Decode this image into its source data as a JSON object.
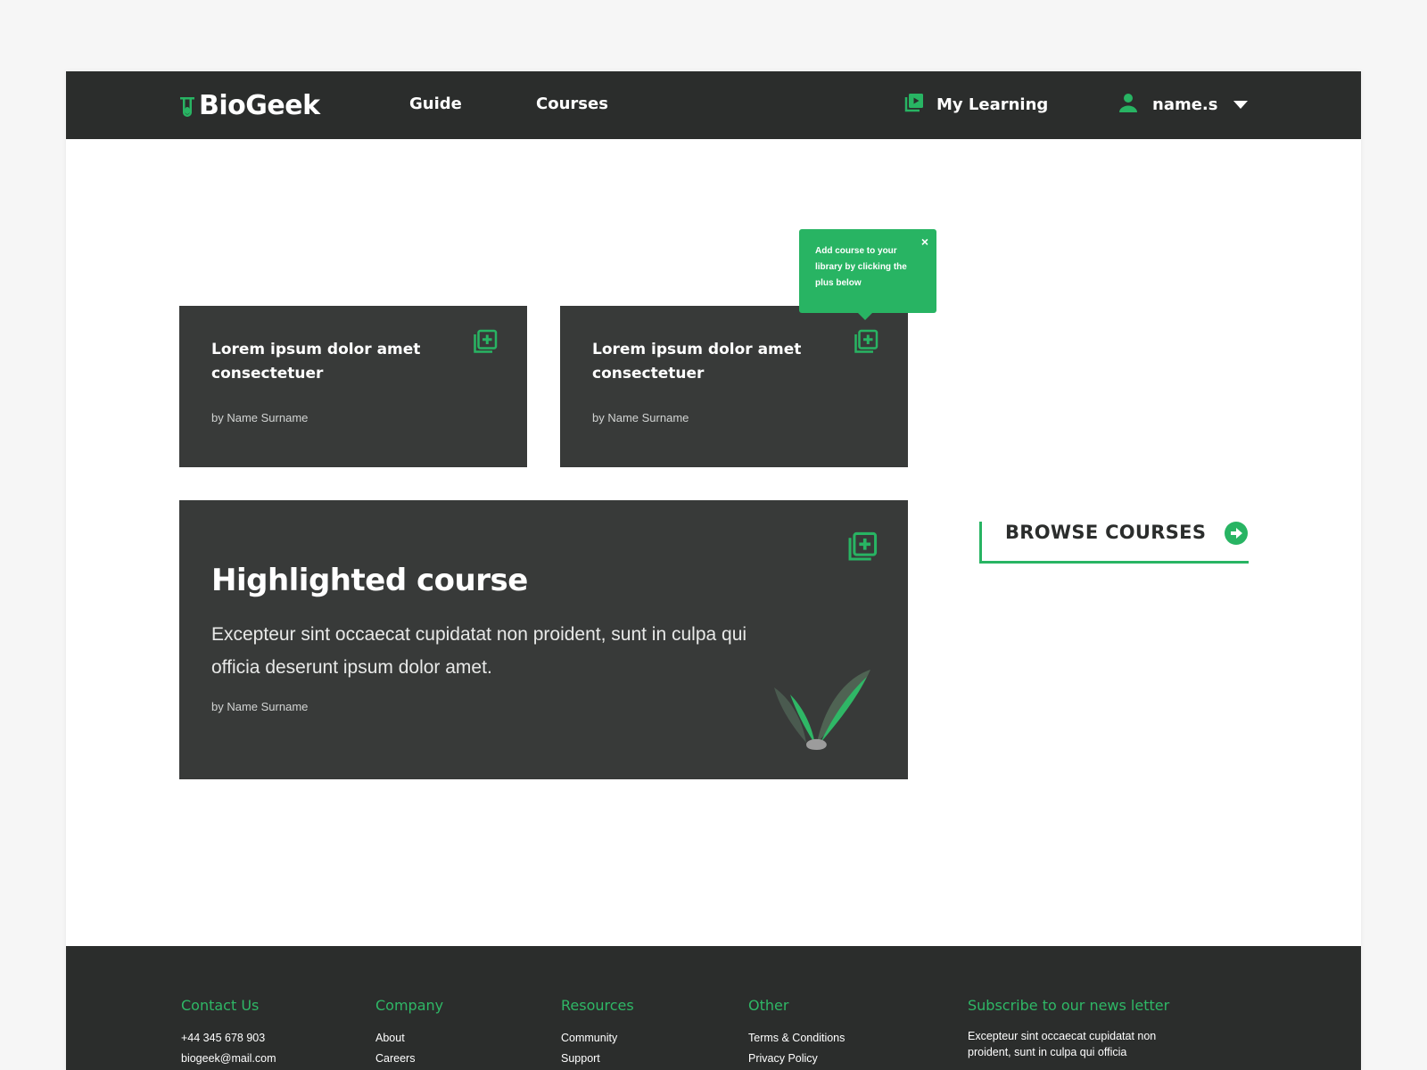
{
  "brand": {
    "name": "BioGeek",
    "accent": "#28b463",
    "dark": "#2b2d2c",
    "card": "#383a39"
  },
  "nav": {
    "guide": "Guide",
    "courses": "Courses",
    "my_learning": "My Learning",
    "my_learning_icon": "play-library-icon",
    "user": "name.s",
    "user_icon": "user-icon"
  },
  "tooltip": {
    "text": "Add course to your library by clicking the plus below",
    "close": "×"
  },
  "cards": [
    {
      "title": "Lorem ipsum dolor amet consectetuer",
      "author": "by Name Surname",
      "icon": "add-to-library-icon"
    },
    {
      "title": "Lorem ipsum dolor amet consectetuer",
      "author": "by Name Surname",
      "icon": "add-to-library-icon"
    }
  ],
  "highlight": {
    "title": "Highlighted course",
    "description": "Excepteur sint occaecat cupidatat non proident, sunt in culpa qui officia deserunt ipsum dolor amet.",
    "author": "by Name Surname",
    "icon": "add-to-library-icon"
  },
  "browse": {
    "label": "BROWSE COURSES",
    "icon": "arrow-right-circle-icon"
  },
  "footer": {
    "contact": {
      "heading": "Contact Us",
      "phone": "+44 345 678 903",
      "email": "biogeek@mail.com"
    },
    "company": {
      "heading": "Company",
      "links": [
        "About",
        "Careers"
      ]
    },
    "resources": {
      "heading": "Resources",
      "links": [
        "Community",
        "Support"
      ]
    },
    "other": {
      "heading": "Other",
      "links": [
        "Terms & Conditions",
        "Privacy Policy"
      ]
    },
    "newsletter": {
      "heading": "Subscribe to our news letter",
      "text": "Excepteur sint occaecat cupidatat non proident, sunt in culpa qui officia"
    }
  }
}
